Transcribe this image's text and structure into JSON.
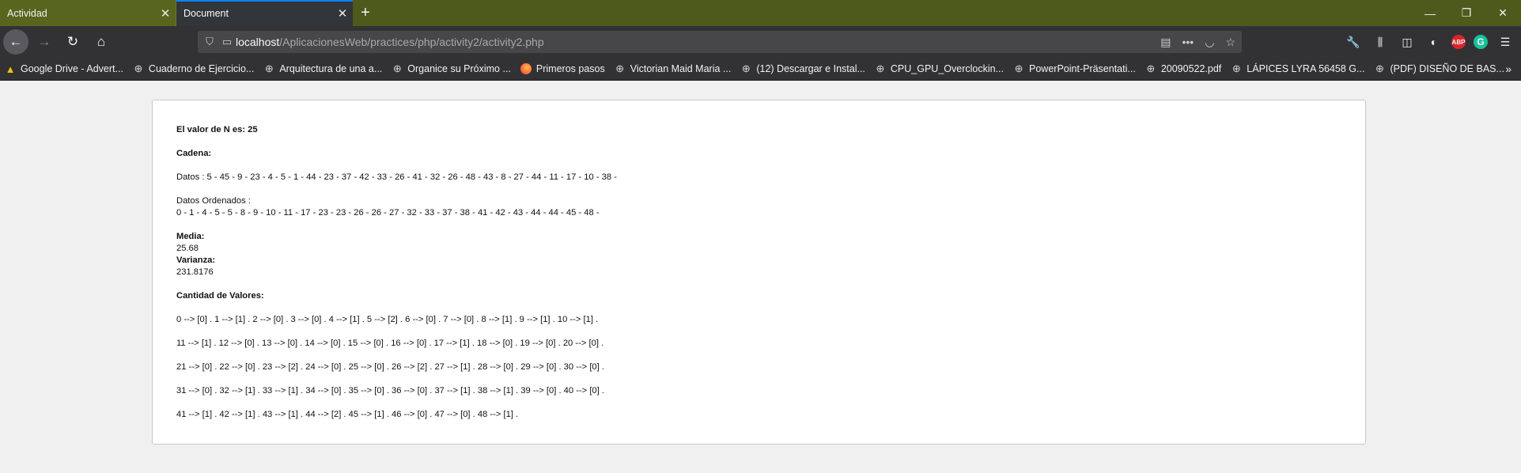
{
  "tabs": [
    {
      "title": "Actividad",
      "active": false
    },
    {
      "title": "Document",
      "active": true
    }
  ],
  "window_controls": {
    "minimize": "—",
    "restore": "❐",
    "close": "✕"
  },
  "nav": {
    "back": "←",
    "forward": "→",
    "reload": "↻",
    "home": "⌂"
  },
  "url": {
    "host": "localhost",
    "path": "/AplicacionesWeb/practices/php/activity2/activity2.php"
  },
  "bookmarks": [
    {
      "label": "Google Drive - Advert...",
      "icon": "drive-icon"
    },
    {
      "label": "Cuaderno de Ejercicio...",
      "icon": "globe-icon"
    },
    {
      "label": "Arquitectura de una a...",
      "icon": "globe-icon"
    },
    {
      "label": "Organice su Próximo ...",
      "icon": "globe-icon"
    },
    {
      "label": "Primeros pasos",
      "icon": "firefox-icon"
    },
    {
      "label": "Victorian Maid Maria ...",
      "icon": "globe-icon"
    },
    {
      "label": "(12) Descargar e Instal...",
      "icon": "globe-icon"
    },
    {
      "label": "CPU_GPU_Overclockin...",
      "icon": "globe-icon"
    },
    {
      "label": "PowerPoint-Präsentati...",
      "icon": "globe-icon"
    },
    {
      "label": "20090522.pdf",
      "icon": "globe-icon"
    },
    {
      "label": "LÁPICES LYRA 56458 G...",
      "icon": "globe-icon"
    },
    {
      "label": "(PDF) DISEÑO DE BAS...",
      "icon": "globe-icon"
    }
  ],
  "page": {
    "n_label": "El valor de N es: 25",
    "cadena_label": "Cadena:",
    "datos": "Datos : 5 - 45 - 9 - 23 - 4 - 5 - 1 - 44 - 23 - 37 - 42 - 33 - 26 - 41 - 32 - 26 - 48 - 43 - 8 - 27 - 44 - 11 - 17 - 10 - 38 -",
    "ordenados_label": "Datos Ordenados :",
    "ordenados": "0 - 1 - 4 - 5 - 5 - 8 - 9 - 10 - 11 - 17 - 23 - 23 - 26 - 26 - 27 - 32 - 33 - 37 - 38 - 41 - 42 - 43 - 44 - 44 - 45 - 48 -",
    "media_label": "Media:",
    "media_value": "25.68",
    "varianza_label": "Varianza:",
    "varianza_value": "231.8176",
    "cantidad_label": "Cantidad de Valores:",
    "cantidad_rows": [
      "0 --> [0] . 1 --> [1] . 2 --> [0] . 3 --> [0] . 4 --> [1] . 5 --> [2] . 6 --> [0] . 7 --> [0] . 8 --> [1] . 9 --> [1] . 10 --> [1] .",
      "11 --> [1] . 12 --> [0] . 13 --> [0] . 14 --> [0] . 15 --> [0] . 16 --> [0] . 17 --> [1] . 18 --> [0] . 19 --> [0] . 20 --> [0] .",
      "21 --> [0] . 22 --> [0] . 23 --> [2] . 24 --> [0] . 25 --> [0] . 26 --> [2] . 27 --> [1] . 28 --> [0] . 29 --> [0] . 30 --> [0] .",
      "31 --> [0] . 32 --> [1] . 33 --> [1] . 34 --> [0] . 35 --> [0] . 36 --> [0] . 37 --> [1] . 38 --> [1] . 39 --> [0] . 40 --> [0] .",
      "41 --> [1] . 42 --> [1] . 43 --> [1] . 44 --> [2] . 45 --> [1] . 46 --> [0] . 47 --> [0] . 48 --> [1] ."
    ]
  }
}
